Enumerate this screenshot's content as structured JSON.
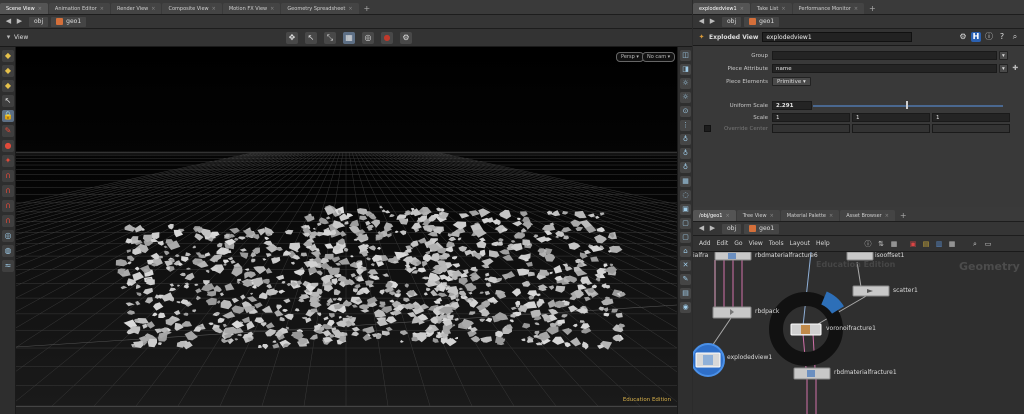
{
  "scene_tabs": [
    {
      "label": "Scene View",
      "active": true
    },
    {
      "label": "Animation Editor",
      "active": false
    },
    {
      "label": "Render View",
      "active": false
    },
    {
      "label": "Composite View",
      "active": false
    },
    {
      "label": "Motion FX View",
      "active": false
    },
    {
      "label": "Geometry Spreadsheet",
      "active": false
    }
  ],
  "params_tabs": [
    {
      "label": "explodedview1",
      "active": true
    },
    {
      "label": "Take List",
      "active": false
    },
    {
      "label": "Performance Monitor",
      "active": false
    }
  ],
  "network_tabs": [
    {
      "label": "/obj/geo1",
      "active": true
    },
    {
      "label": "Tree View",
      "active": false
    },
    {
      "label": "Material Palette",
      "active": false
    },
    {
      "label": "Asset Browser",
      "active": false
    }
  ],
  "path": {
    "root": "obj",
    "node": "geo1"
  },
  "viewport": {
    "label": "View",
    "persp_btn": "Persp",
    "cam_btn": "No cam",
    "edition": "Education Edition"
  },
  "params": {
    "node_type": "Exploded View",
    "node_name": "explodedview1",
    "group_label": "Group",
    "group_value": "",
    "piece_attr_label": "Piece Attribute",
    "piece_attr_value": "name",
    "piece_elem_label": "Piece Elements",
    "piece_elem_value": "Primitive",
    "uniform_scale_label": "Uniform Scale",
    "uniform_scale_value": "2.291",
    "uniform_scale_fraction": 0.49,
    "scale_label": "Scale",
    "scale_values": [
      "1",
      "1",
      "1"
    ],
    "override_center_label": "Override Center"
  },
  "network": {
    "menu": [
      "Add",
      "Edit",
      "Go",
      "View",
      "Tools",
      "Layout",
      "Help"
    ],
    "watermark_edu": "Education Edition",
    "watermark_geo": "Geometry",
    "nodes": {
      "top": "rbdmaterialfracture6",
      "isooffset": "isooffset1",
      "scatter": "scatter1",
      "rbdpack": "rbdpack",
      "voronoi": "voronoifracture1",
      "exploded": "explodedview1",
      "rbdmat": "rbdmaterialfracture1",
      "left_cut": "ialfra"
    }
  }
}
